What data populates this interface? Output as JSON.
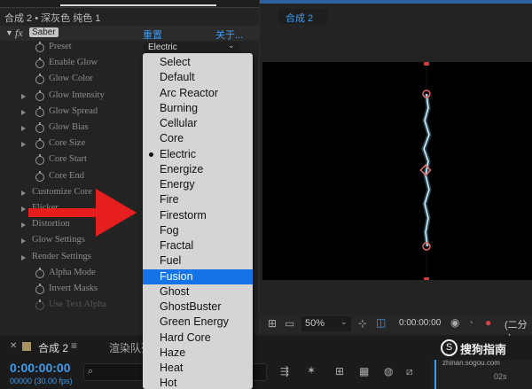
{
  "effect_controls": {
    "title": "合成 2 • 深灰色 纯色 1",
    "effect_name": "Saber",
    "reset_label": "重置",
    "about_label": "关于...",
    "dropdown_value": "Electric",
    "params": [
      {
        "label": "Preset"
      },
      {
        "label": "Enable Glow"
      },
      {
        "label": "Glow Color"
      },
      {
        "label": "Glow Intensity"
      },
      {
        "label": "Glow Spread"
      },
      {
        "label": "Glow Bias"
      },
      {
        "label": "Core Size"
      },
      {
        "label": "Core Start"
      },
      {
        "label": "Core End"
      },
      {
        "label": "Customize Core"
      },
      {
        "label": "Flicker"
      },
      {
        "label": "Distortion"
      },
      {
        "label": "Glow Settings"
      },
      {
        "label": "Render Settings"
      },
      {
        "label": "Alpha Mode"
      },
      {
        "label": "Invert Masks"
      },
      {
        "label": "Use Text Alpha"
      }
    ]
  },
  "preset_menu": {
    "items": [
      "Select",
      "Default",
      "Arc Reactor",
      "Burning",
      "Cellular",
      "Core",
      "Electric",
      "Energize",
      "Energy",
      "Fire",
      "Firestorm",
      "Fog",
      "Fractal",
      "Fuel",
      "Fusion",
      "Ghost",
      "GhostBuster",
      "Green Energy",
      "Hard Core",
      "Haze",
      "Heat",
      "Hot"
    ],
    "checked": "Electric",
    "highlighted": "Fusion"
  },
  "viewer": {
    "tab_label": "合成 2",
    "zoom": "50%",
    "timecode": "0:00:00:00",
    "resolution": "(二分之",
    "colors": {
      "beam": "#6fd0ff",
      "handle": "#d03a3a",
      "accent": "#3d9cf0"
    }
  },
  "timeline": {
    "tab_label": "合成 2",
    "render_queue_tab": "渲染队列",
    "current_time": "0:00:00:00",
    "fps": "00000 (30.00 fps)",
    "ruler_label": "02s"
  },
  "watermark": {
    "brand": "搜狗指南",
    "url": "zhinan.sogou.com"
  }
}
